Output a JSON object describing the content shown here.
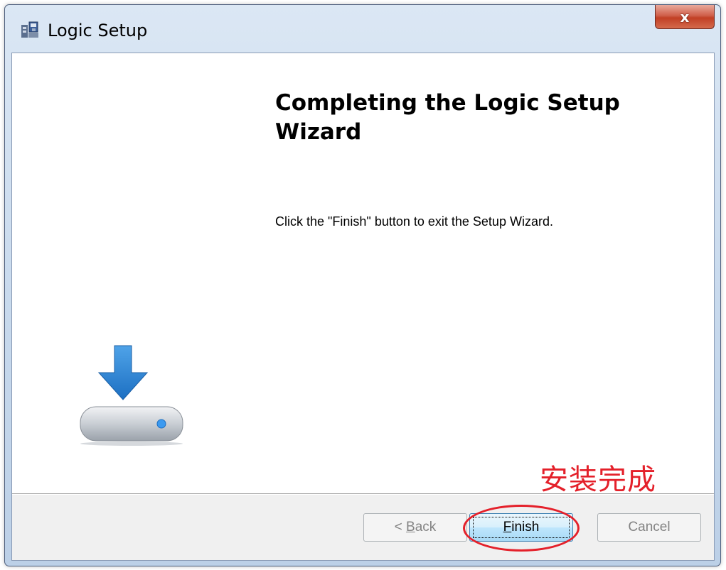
{
  "window": {
    "title": "Logic Setup",
    "close_glyph": "x"
  },
  "icons": {
    "app": "installer-icon",
    "graphic": "download-to-drive-icon",
    "close": "close-icon"
  },
  "main": {
    "heading": "Completing the Logic Setup Wizard",
    "description": "Click the \"Finish\" button to exit the Setup Wizard."
  },
  "annotation": {
    "text": "安装完成",
    "color": "#e4202a"
  },
  "buttons": {
    "back": {
      "label_prefix": "< ",
      "mnemonic": "B",
      "label_rest": "ack",
      "enabled": false
    },
    "finish": {
      "mnemonic": "F",
      "label_rest": "inish",
      "enabled": true,
      "focused": true
    },
    "cancel": {
      "label": "Cancel",
      "enabled": false
    }
  }
}
